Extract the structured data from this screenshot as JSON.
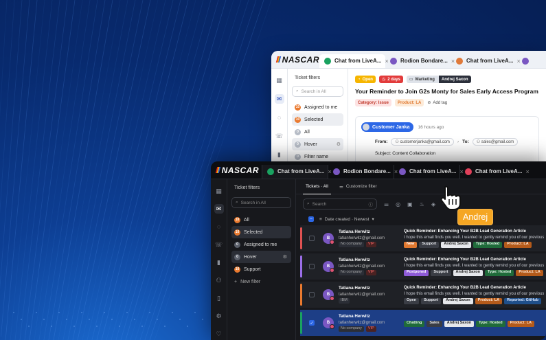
{
  "colors": {
    "accent_blue": "#2c67e6",
    "orange": "#ea7a2f",
    "background_deep": "#061f55",
    "name_tag": "#f5a623"
  },
  "light": {
    "logo": "NASCAR",
    "tabs": [
      {
        "label": "Chat from LiveA...",
        "icon": "chat-icon",
        "color": "#1aa260"
      },
      {
        "label": "Rodion Bondare...",
        "icon": "person-icon",
        "color": "#7a57c2"
      },
      {
        "label": "Chat from LiveA...",
        "icon": "chat-icon",
        "color": "#e07a3a"
      },
      {
        "label": "",
        "icon": "chat-icon",
        "color": "#7a57c2"
      }
    ],
    "filters_title": "Ticket filters",
    "search_placeholder": "Search in All",
    "filters": [
      {
        "label": "Assigned to me",
        "count": "10",
        "selected": false
      },
      {
        "label": "Selected",
        "count": "10",
        "selected": true
      },
      {
        "label": "All",
        "count": "0",
        "selected": false
      },
      {
        "label": "Hover",
        "count": "0",
        "selected": false
      },
      {
        "label": "Filter name",
        "count": "0",
        "selected": false
      }
    ],
    "ticket": {
      "status": "Open",
      "age": "2 days",
      "team": "Marketing",
      "assignee": "Andrej Saxon",
      "title": "Your Reminder to Join G2s Monty for Sales Early Access Program",
      "category": "Category: Issue",
      "product": "Product: LA",
      "add_tag": "Add tag",
      "sender": "Customer Janka",
      "time_ago": "16 hours ago",
      "from_label": "From:",
      "from_email": "customerjanka@gmail.com",
      "to_label": "To:",
      "to_email": "sales@gmail.com",
      "subject": "Subject:  Content Collaboration"
    }
  },
  "dark": {
    "logo": "NASCAR",
    "tabs": [
      {
        "label": "Chat from LiveA...",
        "icon": "chat-icon",
        "color": "#1aa260"
      },
      {
        "label": "Rodion Bondare...",
        "icon": "person-icon",
        "color": "#7a57c2"
      },
      {
        "label": "Chat from LiveA...",
        "icon": "chat-icon",
        "color": "#7a57c2"
      },
      {
        "label": "Chat from LiveA...",
        "icon": "chat-icon",
        "color": "#e0405a"
      }
    ],
    "filters_title": "Ticket filters",
    "search_placeholder": "Search in All",
    "filters": [
      {
        "label": "All",
        "count": "10",
        "selected": false,
        "settings": false
      },
      {
        "label": "Selected",
        "count": "10",
        "selected": true,
        "settings": false
      },
      {
        "label": "Assigned to me",
        "count": "0",
        "selected": false,
        "settings": false
      },
      {
        "label": "Hover",
        "count": "0",
        "selected": true,
        "settings": true
      },
      {
        "label": "Support",
        "count": "10",
        "selected": false,
        "settings": false
      }
    ],
    "new_filter": "New filter",
    "view_tabs": [
      "Tickets · All",
      "Customize filter"
    ],
    "search_placeholder_main": "Search",
    "sort_label": "Date created · Newest",
    "rows": [
      {
        "stripe": "#e05252",
        "checked": false,
        "selected": false,
        "avatar": "B",
        "name": "Tatiana Herwitz",
        "email": "tatianherwitz@gmail.com",
        "company": "No company",
        "company_badge": "VIP",
        "subject": "Quick Reminder: Enhancing Your B2B Lead Generation Article",
        "preview": "I hope this email finds you well. I wanted to gently remind you of our previous",
        "tags": [
          {
            "label": "New",
            "bg": "#e0782f",
            "fg": "#ffffff"
          },
          {
            "label": "Support",
            "bg": "#3a3d45",
            "fg": "#e5e7eb"
          },
          {
            "label": "Andrej Saxon",
            "bg": "#e5e7eb",
            "fg": "#222222"
          },
          {
            "label": "Type: Hosted",
            "bg": "#1f6b3a",
            "fg": "#e7f6ec"
          },
          {
            "label": "Product: LA",
            "bg": "#b45a1a",
            "fg": "#ffe8d6"
          }
        ]
      },
      {
        "stripe": "#9b6ee8",
        "checked": false,
        "selected": false,
        "avatar": "B",
        "name": "Tatiana Herwitz",
        "email": "tatianherwitz@gmail.com",
        "company": "No company",
        "company_badge": "VIP",
        "subject": "Quick Reminder: Enhancing Your B2B Lead Generation Article",
        "preview": "I hope this email finds you well. I wanted to gently remind you of our previous",
        "tags": [
          {
            "label": "Postponed",
            "bg": "#8e5bd8",
            "fg": "#ffffff"
          },
          {
            "label": "Support",
            "bg": "#3a3d45",
            "fg": "#e5e7eb"
          },
          {
            "label": "Andrej Saxon",
            "bg": "#e5e7eb",
            "fg": "#222222"
          },
          {
            "label": "Type: Hosted",
            "bg": "#1f6b3a",
            "fg": "#e7f6ec"
          },
          {
            "label": "Product: LA",
            "bg": "#b45a1a",
            "fg": "#ffe8d6"
          }
        ]
      },
      {
        "stripe": "#ea7a2f",
        "checked": false,
        "selected": false,
        "avatar": "B",
        "name": "Tatiana Herwitz",
        "email": "tatianherwitz@gmail.com",
        "company": "IBM",
        "company_badge": "",
        "subject": "Quick Reminder: Enhancing Your B2B Lead Generation Article",
        "preview": "I hope this email finds you well. I wanted to gently remind you of our previous",
        "tags": [
          {
            "label": "Open",
            "bg": "#3a3d45",
            "fg": "#e5e7eb"
          },
          {
            "label": "Support",
            "bg": "#3a3d45",
            "fg": "#e5e7eb"
          },
          {
            "label": "Andrej Saxon",
            "bg": "#e5e7eb",
            "fg": "#222222"
          },
          {
            "label": "Product: LA",
            "bg": "#b45a1a",
            "fg": "#ffe8d6"
          },
          {
            "label": "Reported: GitHub",
            "bg": "#1f4f8a",
            "fg": "#dbe8ff"
          }
        ]
      },
      {
        "stripe": "#1aa260",
        "checked": true,
        "selected": true,
        "avatar": "B",
        "name": "Tatiana Herwitz",
        "email": "tatianherwitz@gmail.com",
        "company": "No company",
        "company_badge": "VIP",
        "subject": "",
        "preview": "",
        "tags": [
          {
            "label": "Chatting",
            "bg": "#1f6b3a",
            "fg": "#e7f6ec"
          },
          {
            "label": "Sales",
            "bg": "#3a3d45",
            "fg": "#e5e7eb"
          },
          {
            "label": "Andrej Saxon",
            "bg": "#e5e7eb",
            "fg": "#222222"
          },
          {
            "label": "Type: Hosted",
            "bg": "#1f6b3a",
            "fg": "#e7f6ec"
          },
          {
            "label": "Product: LA",
            "bg": "#b45a1a",
            "fg": "#ffe8d6"
          }
        ]
      }
    ]
  },
  "cursor_label": "Andrej"
}
